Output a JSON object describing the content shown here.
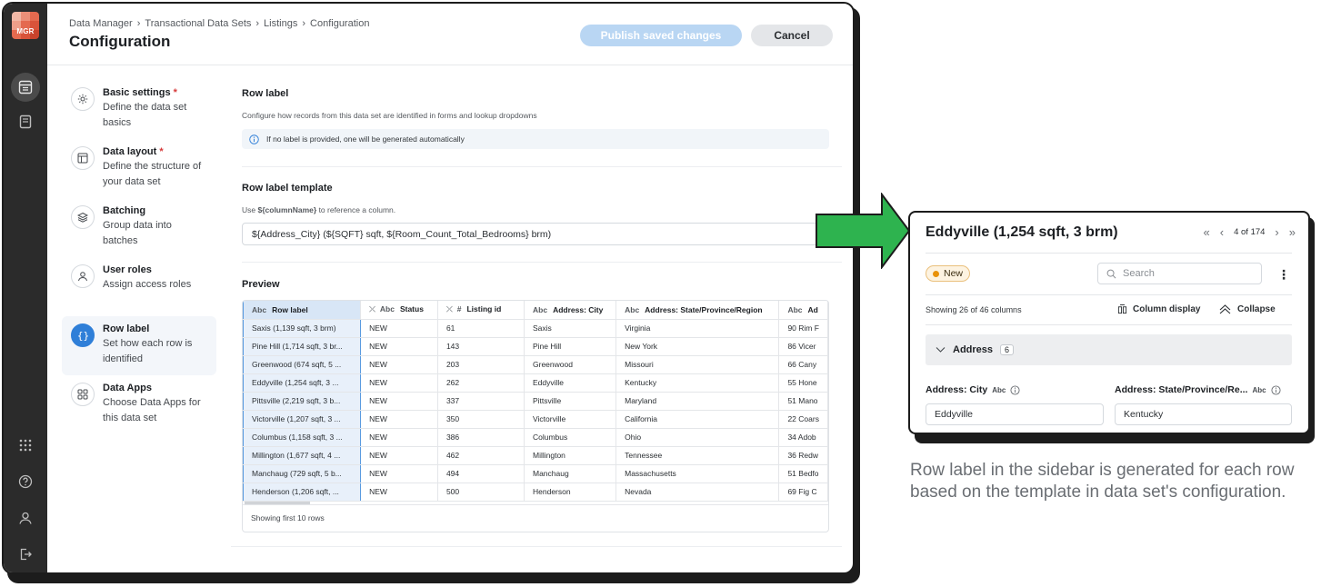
{
  "app": {
    "logo_text": "MGR",
    "logo_colors": [
      "#f2b8a6",
      "#ec8f78",
      "#e46a4f",
      "#ee9f8a",
      "#e46a4f",
      "#d9533a",
      "#e46a4f",
      "#d9533a",
      "#c9432c"
    ]
  },
  "header": {
    "breadcrumb": [
      "Data Manager",
      "Transactional Data Sets",
      "Listings",
      "Configuration"
    ],
    "separator": "›",
    "title": "Configuration",
    "publish_label": "Publish saved changes",
    "cancel_label": "Cancel"
  },
  "steps": [
    {
      "title": "Basic settings",
      "required": "*",
      "desc": "Define the data set basics",
      "icon": "gear-icon"
    },
    {
      "title": "Data layout",
      "required": "*",
      "desc": "Define the structure of your data set",
      "icon": "layout-icon"
    },
    {
      "title": "Batching",
      "required": "",
      "desc": "Group data into batches",
      "icon": "layers-icon"
    },
    {
      "title": "User roles",
      "required": "",
      "desc": "Assign access roles",
      "icon": "user-icon"
    },
    {
      "title": "Row label",
      "required": "",
      "desc": "Set how each row is identified",
      "icon": "braces-icon"
    },
    {
      "title": "Data Apps",
      "required": "",
      "desc": "Choose Data Apps for this data set",
      "icon": "apps-icon"
    }
  ],
  "row_label": {
    "title": "Row label",
    "subtitle": "Configure how records from this data set are identified in forms and lookup dropdowns",
    "info": "If no label is provided, one will be generated automatically"
  },
  "template": {
    "title": "Row label template",
    "hint_prefix": "Use ",
    "hint_code": "${columnName}",
    "hint_suffix": " to reference a column.",
    "value": "${Address_City} (${SQFT} sqft, ${Room_Count_Total_Bedrooms} brm)"
  },
  "preview": {
    "title": "Preview",
    "columns": [
      {
        "type": "Abc",
        "name": "Row label"
      },
      {
        "type": "Abc",
        "name": "Status"
      },
      {
        "type": "#",
        "name": "Listing id"
      },
      {
        "type": "Abc",
        "name": "Address: City"
      },
      {
        "type": "Abc",
        "name": "Address: State/Province/Region"
      },
      {
        "type": "Abc",
        "name": "Ad"
      }
    ],
    "rows": [
      [
        "Saxis (1,139 sqft, 3 brm)",
        "NEW",
        "61",
        "Saxis",
        "Virginia",
        "90 Rim F"
      ],
      [
        "Pine Hill (1,714 sqft, 3 br...",
        "NEW",
        "143",
        "Pine Hill",
        "New York",
        "86 Vicer"
      ],
      [
        "Greenwood (674 sqft, 5 ...",
        "NEW",
        "203",
        "Greenwood",
        "Missouri",
        "66 Cany"
      ],
      [
        "Eddyville (1,254 sqft, 3 ...",
        "NEW",
        "262",
        "Eddyville",
        "Kentucky",
        "55 Hone"
      ],
      [
        "Pittsville (2,219 sqft, 3 b...",
        "NEW",
        "337",
        "Pittsville",
        "Maryland",
        "51 Mano"
      ],
      [
        "Victorville (1,207 sqft, 3 ...",
        "NEW",
        "350",
        "Victorville",
        "California",
        "22 Coars"
      ],
      [
        "Columbus (1,158 sqft, 3 ...",
        "NEW",
        "386",
        "Columbus",
        "Ohio",
        "34 Adob"
      ],
      [
        "Millington (1,677 sqft, 4 ...",
        "NEW",
        "462",
        "Millington",
        "Tennessee",
        "36 Redw"
      ],
      [
        "Manchaug (729 sqft, 5 b...",
        "NEW",
        "494",
        "Manchaug",
        "Massachusetts",
        "51 Bedfo"
      ],
      [
        "Henderson (1,206 sqft, ...",
        "NEW",
        "500",
        "Henderson",
        "Nevada",
        "69 Fig C"
      ]
    ],
    "footer": "Showing first 10 rows"
  },
  "sidebar_panel": {
    "title": "Eddyville (1,254 sqft, 3 brm)",
    "pager": "4 of 174",
    "status": "New",
    "search_placeholder": "Search",
    "showing": "Showing 26 of 46 columns",
    "column_display": "Column display",
    "collapse": "Collapse",
    "group_name": "Address",
    "group_count": "6",
    "fields": [
      {
        "label": "Address: City",
        "type": "Abc",
        "value": "Eddyville"
      },
      {
        "label": "Address: State/Province/Re...",
        "type": "Abc",
        "value": "Kentucky"
      }
    ]
  },
  "caption": "Row label in the sidebar is generated for each row based on the template in data set's configuration.",
  "colors": {
    "arrow_fill": "#2eb34f",
    "arrow_stroke": "#1c1c1c",
    "accent": "#2f7fd8"
  }
}
